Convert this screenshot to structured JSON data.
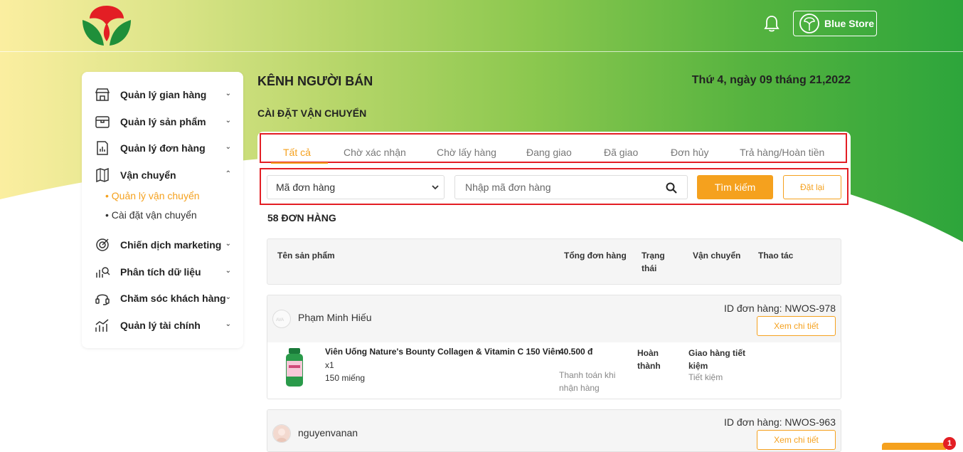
{
  "header": {
    "store_name": "Blue Store"
  },
  "sidebar": {
    "items": [
      {
        "label": "Quản lý gian hàng",
        "icon": "store-icon"
      },
      {
        "label": "Quản lý sản phẩm",
        "icon": "box-icon"
      },
      {
        "label": "Quản lý đơn hàng",
        "icon": "order-icon"
      },
      {
        "label": "Vận chuyển",
        "icon": "map-icon"
      },
      {
        "label": "Chiến dịch marketing",
        "icon": "target-icon"
      },
      {
        "label": "Phân tích dữ liệu",
        "icon": "analytics-icon"
      },
      {
        "label": "Chăm sóc khách hàng",
        "icon": "headset-icon"
      },
      {
        "label": "Quản lý tài chính",
        "icon": "finance-chart-icon"
      }
    ],
    "sub_items": [
      {
        "label": "Quản lý vận chuyển",
        "active": true
      },
      {
        "label": "Cài đặt vận chuyển",
        "active": false
      }
    ]
  },
  "main": {
    "title": "KÊNH NGƯỜI BÁN",
    "date": "Thứ 4, ngày 09 tháng 21,2022",
    "section_title": "CÀI ĐẶT VẬN CHUYỂN",
    "tabs": [
      {
        "label": "Tất cả",
        "active": true
      },
      {
        "label": "Chờ xác nhận"
      },
      {
        "label": "Chờ lấy hàng"
      },
      {
        "label": "Đang giao"
      },
      {
        "label": "Đã giao"
      },
      {
        "label": "Đơn hủy"
      },
      {
        "label": "Trả hàng/Hoàn tiền"
      }
    ],
    "filter": {
      "select_value": "Mã đơn hàng",
      "search_placeholder": "Nhập mã đơn hàng",
      "search_button": "Tìm kiếm",
      "reset_button": "Đặt lại"
    },
    "order_count": "58 ĐƠN HÀNG",
    "table_headers": {
      "product": "Tên sản phẩm",
      "total": "Tổng đơn hàng",
      "status": "Trạng thái",
      "shipping": "Vận chuyển",
      "actions": "Thao tác"
    },
    "orders": [
      {
        "customer": "Phạm Minh Hiếu",
        "order_id": "ID đơn hàng: NWOS-978",
        "detail_button": "Xem chi tiết",
        "product_name": "Viên Uống Nature's Bounty Collagen & Vitamin C 150 Viên",
        "quantity": "x1",
        "unit": "150 miếng",
        "price": "40.500 đ",
        "payment": "Thanh toán khi nhận hàng",
        "status": "Hoàn thành",
        "shipping": "Giao hàng tiết kiệm",
        "shipping_type": "Tiết kiệm"
      },
      {
        "customer": "nguyenvanan",
        "order_id": "ID đơn hàng: NWOS-963",
        "detail_button": "Xem chi tiết"
      }
    ]
  },
  "chat": {
    "badge": "1"
  },
  "colors": {
    "accent": "#f5a11e",
    "highlight_border": "#e31e24",
    "brand_green": "#2da53b"
  }
}
